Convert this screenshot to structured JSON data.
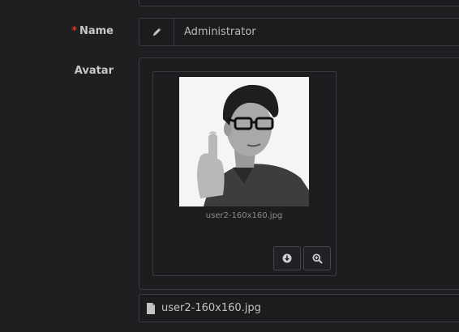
{
  "form": {
    "name": {
      "label": "Name",
      "required_mark": "*",
      "icon": "pencil-icon",
      "value": "Administrator"
    },
    "avatar": {
      "label": "Avatar",
      "preview_caption": "user2-160x160.jpg",
      "download_icon": "download-icon",
      "zoom_icon": "zoom-in-icon",
      "file_icon": "file-icon",
      "file_name": "user2-160x160.jpg"
    }
  },
  "colors": {
    "required": "#e0342f",
    "background": "#1e1f21",
    "border": "#3a3b3e"
  }
}
